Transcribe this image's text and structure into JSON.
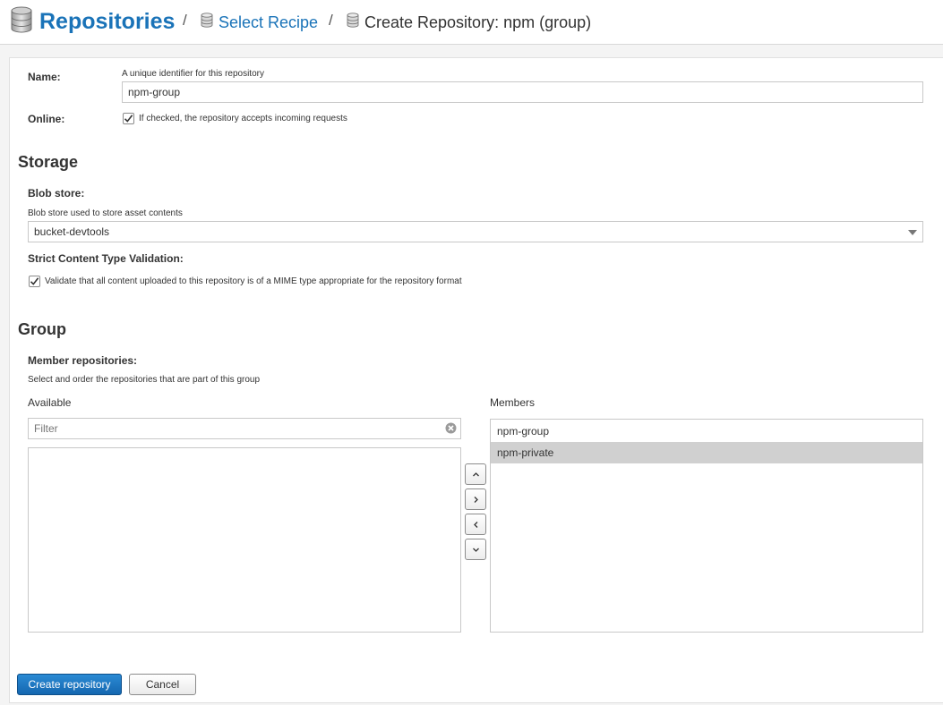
{
  "breadcrumb": {
    "root_label": "Repositories",
    "separator": "/",
    "recipe_label": "Select Recipe",
    "current_label": "Create Repository: npm (group)",
    "icon": "database-icon"
  },
  "form": {
    "name": {
      "label": "Name:",
      "help": "A unique identifier for this repository",
      "value": "npm-group"
    },
    "online": {
      "label": "Online:",
      "checked": true,
      "help": "If checked, the repository accepts incoming requests"
    },
    "storage": {
      "title": "Storage",
      "blob_store": {
        "label": "Blob store:",
        "help": "Blob store used to store asset contents",
        "value": "bucket-devtools"
      },
      "strict_content": {
        "label": "Strict Content Type Validation:",
        "checked": true,
        "help": "Validate that all content uploaded to this repository is of a MIME type appropriate for the repository format"
      }
    },
    "group": {
      "title": "Group",
      "members_label": "Member repositories:",
      "members_help": "Select and order the repositories that are part of this group",
      "available_title": "Available",
      "filter_placeholder": "Filter",
      "members_title": "Members",
      "members": [
        "npm-group",
        "npm-private"
      ],
      "selected_member": "npm-private"
    }
  },
  "actions": {
    "create_label": "Create repository",
    "cancel_label": "Cancel"
  },
  "colors": {
    "accent": "#1a73b8",
    "primary_button": "#1a6fb5",
    "selected_row": "#d0d0d0"
  }
}
